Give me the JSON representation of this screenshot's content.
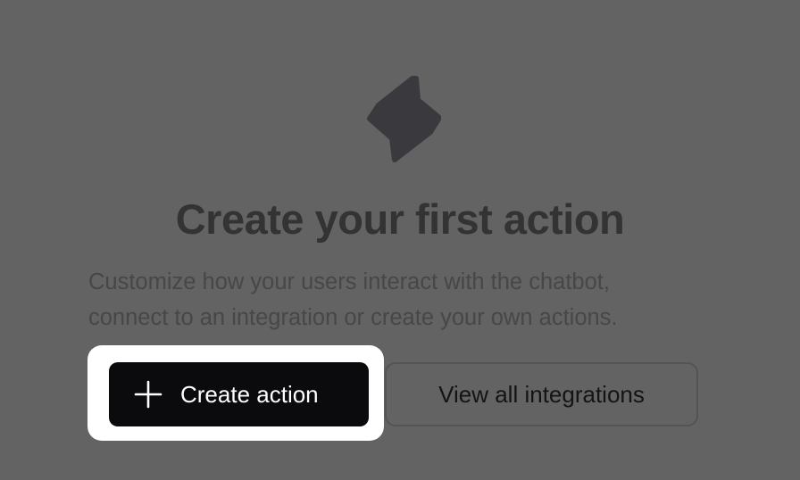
{
  "empty_state": {
    "icon": "lightning-bolt-icon",
    "title": "Create your first action",
    "description_line1": "Customize how your users interact with the chatbot,",
    "description_line2": "connect to an integration or create your own actions."
  },
  "actions": {
    "create_label": "Create action",
    "create_icon": "plus-icon",
    "integrations_label": "View all integrations"
  },
  "colors": {
    "overlay_background": "#636363",
    "primary_button": "#0b0b0d",
    "highlight": "#ffffff",
    "icon": "#3a3a3e"
  }
}
